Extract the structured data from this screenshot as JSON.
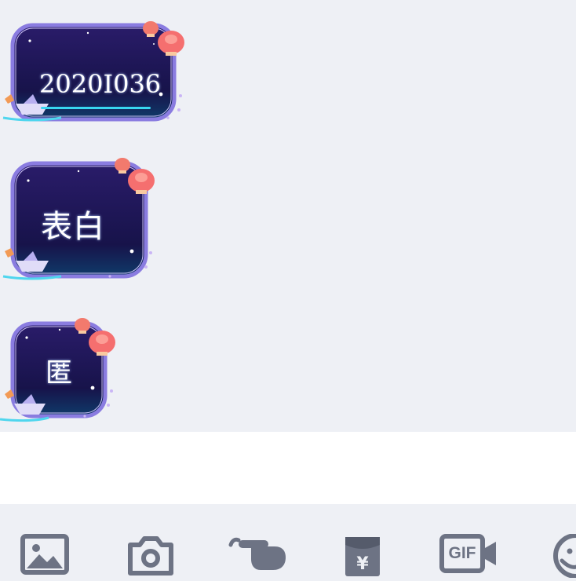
{
  "chat": {
    "messages": [
      {
        "text": "2020I036"
      },
      {
        "text": "表白"
      },
      {
        "text": "匿"
      }
    ]
  },
  "input": {
    "placeholder": "",
    "value": ""
  },
  "toolbar": {
    "items": [
      {
        "icon": "image-icon"
      },
      {
        "icon": "camera-icon"
      },
      {
        "icon": "poke-icon"
      },
      {
        "icon": "red-packet-icon"
      },
      {
        "icon": "gif-icon",
        "label": "GIF"
      },
      {
        "icon": "emoji-icon"
      }
    ]
  },
  "colors": {
    "background": "#eef0f5",
    "bubble_dark": "#1c1650",
    "bubble_border": "#7b6dd6",
    "accent_cyan": "#38d7f0",
    "lantern": "#f56f6f",
    "toolbar_icon": "#6d7384"
  }
}
